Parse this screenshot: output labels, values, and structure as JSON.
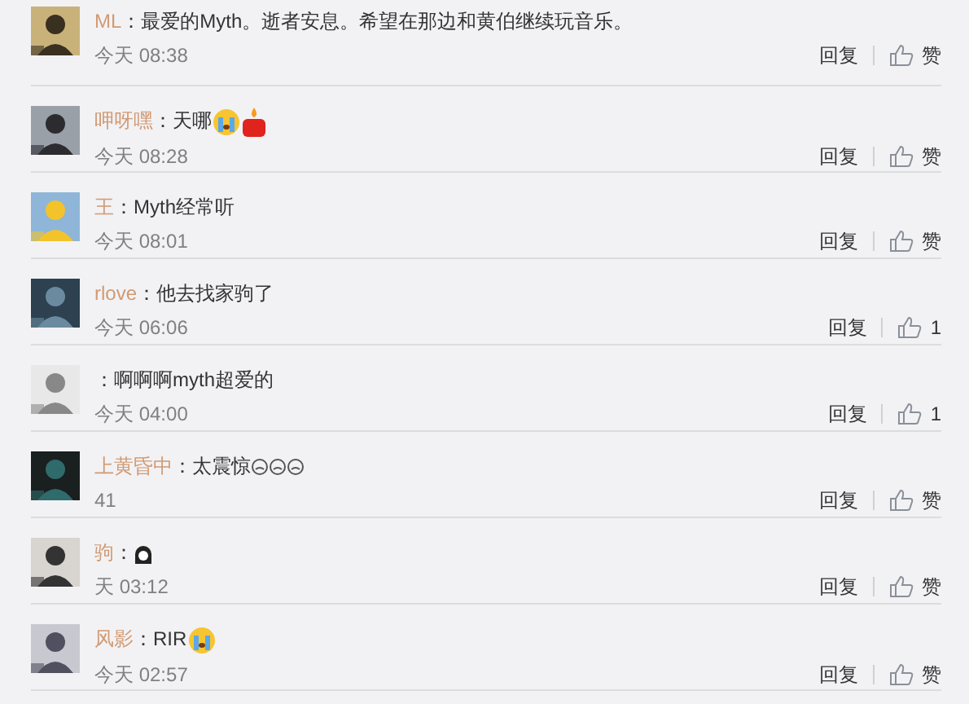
{
  "comments": [
    {
      "user": "ML",
      "text": "：最爱的Myth。逝者安息。希望在那边和黄伯继续玩音乐。",
      "time": "今天 08:38",
      "reply": "回复",
      "like": "赞"
    },
    {
      "user": "呷呀嘿",
      "text": "：天哪",
      "emojis": [
        {
          "kind": "cry"
        },
        {
          "kind": "candle"
        }
      ],
      "time": "今天 08:28",
      "reply": "回复",
      "like": "赞"
    },
    {
      "user": "王",
      "text": "：Myth经常听",
      "time": "今天 08:01",
      "reply": "回复",
      "like": "赞"
    },
    {
      "user": "rlove",
      "text": "：他去找家驹了",
      "time": "今天 06:06",
      "reply": "回复",
      "like": "1"
    },
    {
      "text": "：啊啊啊myth超爱的",
      "time": "今天 04:00",
      "reply": "回复",
      "like": "1"
    },
    {
      "user": "上黄昏中",
      "text": "：太震惊",
      "emojis": [
        {
          "kind": "face"
        },
        {
          "kind": "face"
        },
        {
          "kind": "face"
        }
      ],
      "time": "41",
      "reply": "回复",
      "like": "赞"
    },
    {
      "user": "驹",
      "text": "：",
      "emojis": [
        {
          "kind": "ghost"
        }
      ],
      "time": "天 03:12",
      "reply": "回复",
      "like": "赞"
    },
    {
      "user": "风影",
      "text": "：RIR",
      "emojis": [
        {
          "kind": "cry"
        }
      ],
      "time": "今天 02:57",
      "reply": "回复",
      "like": "赞"
    }
  ]
}
